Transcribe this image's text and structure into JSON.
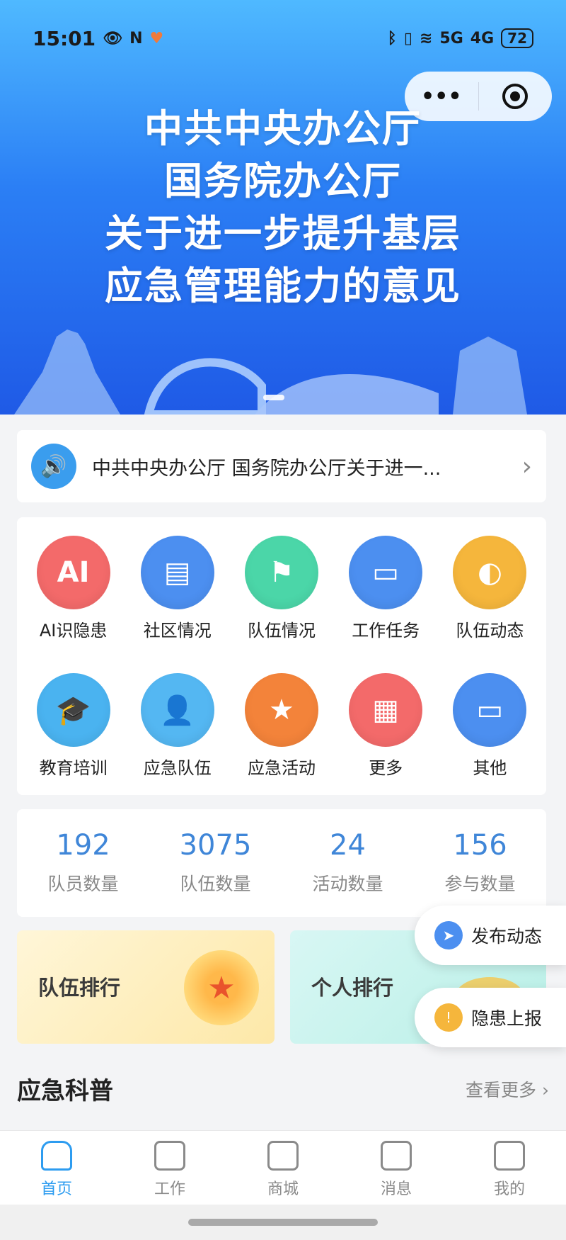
{
  "status_bar": {
    "time": "15:01",
    "battery": "72",
    "net1": "5G",
    "net2": "4G"
  },
  "hero": {
    "lines": [
      "中共中央办公厅",
      "国务院办公厅",
      "关于进一步提升基层",
      "应急管理能力的意见"
    ]
  },
  "notice": {
    "text": "中共中央办公厅 国务院办公厅关于进一..."
  },
  "grid": {
    "items": [
      {
        "label": "AI识隐患",
        "icon_text": "AI",
        "color": "#f36a6a"
      },
      {
        "label": "社区情况",
        "icon_text": "▤",
        "color": "#4c8ff0"
      },
      {
        "label": "队伍情况",
        "icon_text": "⚑",
        "color": "#4bd6a8"
      },
      {
        "label": "工作任务",
        "icon_text": "▭",
        "color": "#4c8ff0"
      },
      {
        "label": "队伍动态",
        "icon_text": "◐",
        "color": "#f5b63c"
      },
      {
        "label": "教育培训",
        "icon_text": "🎓",
        "color": "#4ab3f0"
      },
      {
        "label": "应急队伍",
        "icon_text": "👤",
        "color": "#54b7f2"
      },
      {
        "label": "应急活动",
        "icon_text": "★",
        "color": "#f3833a"
      },
      {
        "label": "更多",
        "icon_text": "▦",
        "color": "#f36a6a"
      },
      {
        "label": "其他",
        "icon_text": "▭",
        "color": "#4c8ff0"
      }
    ]
  },
  "stats": [
    {
      "value": "192",
      "label": "队员数量"
    },
    {
      "value": "3075",
      "label": "队伍数量"
    },
    {
      "value": "24",
      "label": "活动数量"
    },
    {
      "value": "156",
      "label": "参与数量"
    }
  ],
  "ranks": {
    "team": "队伍排行",
    "person": "个人排行"
  },
  "floating": {
    "post": "发布动态",
    "report": "隐患上报"
  },
  "section": {
    "title": "应急科普",
    "more": "查看更多"
  },
  "tabs": [
    {
      "label": "首页"
    },
    {
      "label": "工作"
    },
    {
      "label": "商城"
    },
    {
      "label": "消息"
    },
    {
      "label": "我的"
    }
  ],
  "colors": {
    "accent": "#2d9cf0",
    "stat_blue": "#3f86d8"
  }
}
